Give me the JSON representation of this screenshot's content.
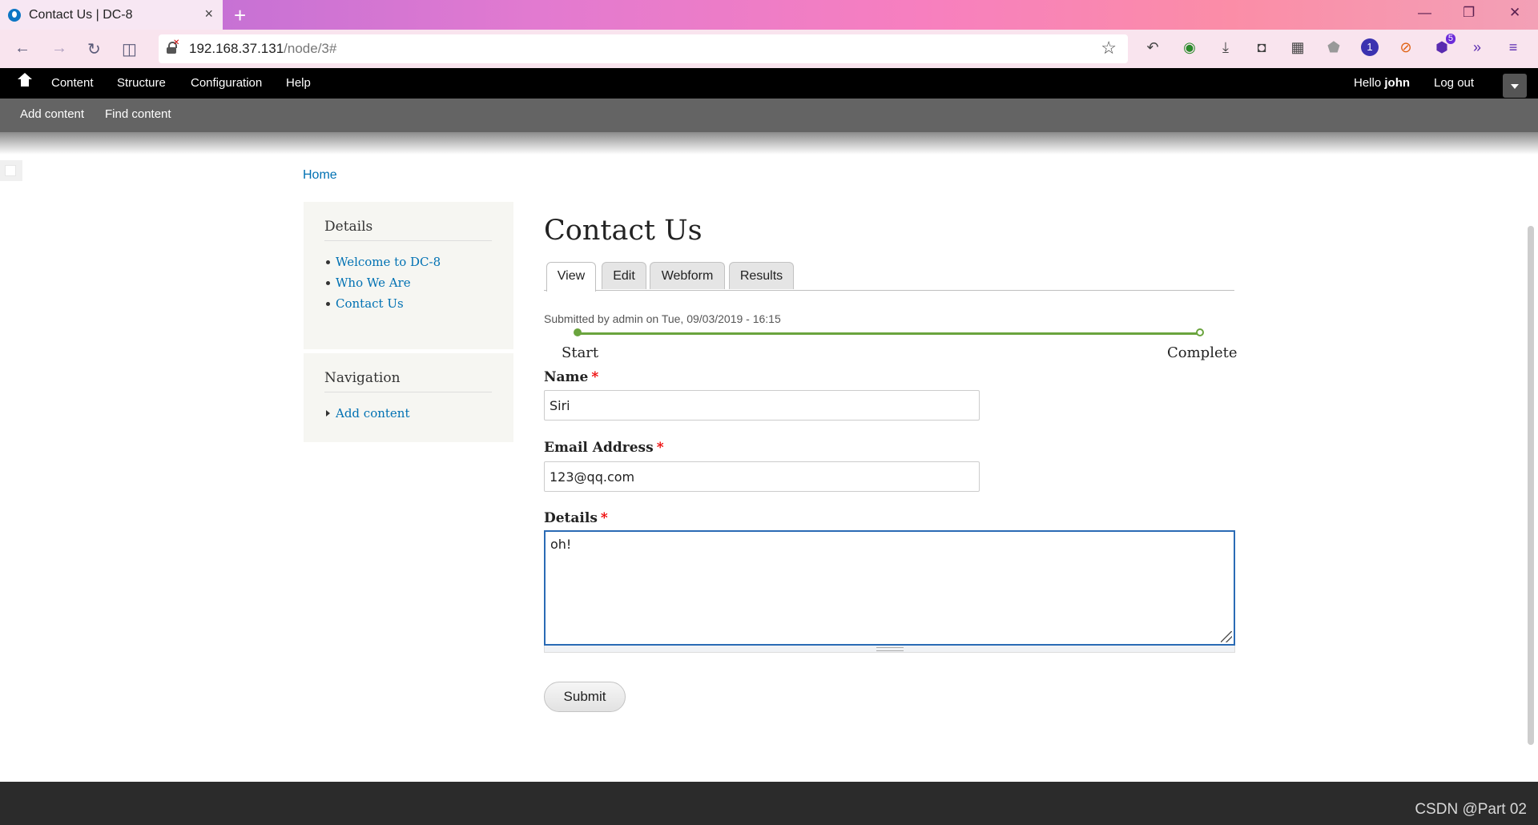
{
  "browser": {
    "tab_title": "Contact Us | DC-8",
    "tab_close": "×",
    "new_tab": "+",
    "url_host": "192.168.37.131",
    "url_path": "/node/3#",
    "minimize": "—",
    "restore": "❐",
    "close": "✕",
    "extension_badge": "5",
    "onepassword_label": "1"
  },
  "toolbar": {
    "items": [
      "Content",
      "Structure",
      "Configuration",
      "Help"
    ],
    "hello_prefix": "Hello",
    "user": "john",
    "logout": "Log out"
  },
  "tray": {
    "items": [
      "Add content",
      "Find content"
    ]
  },
  "breadcrumb": "Home",
  "sidebar": {
    "details": {
      "title": "Details",
      "links": [
        "Welcome to DC-8",
        "Who We Are",
        "Contact Us"
      ]
    },
    "navigation": {
      "title": "Navigation",
      "links": [
        "Add content"
      ]
    }
  },
  "main": {
    "title": "Contact Us",
    "tabs": [
      "View",
      "Edit",
      "Webform",
      "Results"
    ],
    "active_tab": "View",
    "submitted": "Submitted by admin on Tue, 09/03/2019 - 16:15",
    "progress": {
      "start_label": "Start",
      "end_label": "Complete"
    },
    "form": {
      "name_label": "Name",
      "name_value": "Siri",
      "email_label": "Email Address",
      "email_value": "123@qq.com",
      "details_label": "Details",
      "details_value": "oh!",
      "required_marker": "*",
      "submit_label": "Submit"
    }
  },
  "watermark": "CSDN @Part 02"
}
